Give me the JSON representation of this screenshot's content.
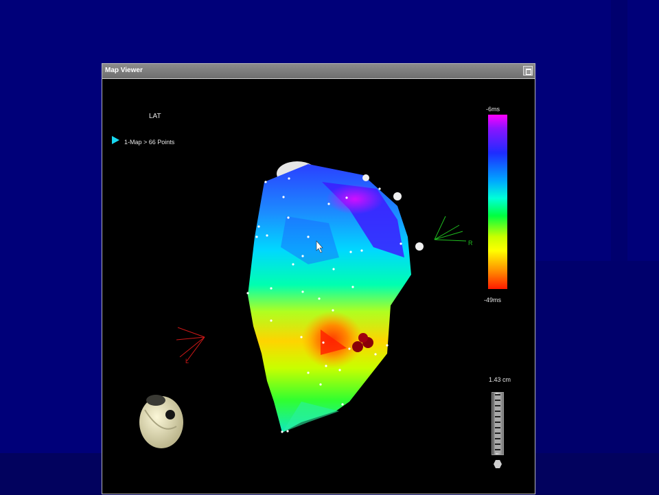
{
  "window": {
    "title": "Map Viewer"
  },
  "map": {
    "label": "LAT",
    "map_info": "1-Map > 66 Points"
  },
  "color_scale": {
    "max_label": "-6ms",
    "min_label": "-49ms"
  },
  "distance_scale": {
    "label": "1.43 cm"
  },
  "orientation": {
    "right_label": "R",
    "left_label": "L"
  },
  "icons": [
    "play-icon",
    "maximize-icon",
    "cursor-icon",
    "heart-icon",
    "hexagon-icon"
  ],
  "colors": {
    "desktop": "#000079",
    "titlebar": "#7c7c7c",
    "accent": "#18d8f0"
  }
}
